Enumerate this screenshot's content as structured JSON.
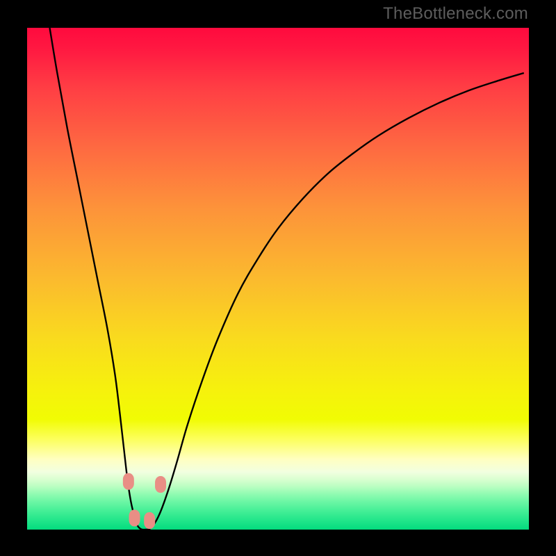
{
  "watermark": "TheBottleneck.com",
  "colors": {
    "background": "#000000",
    "curve_stroke": "#000000",
    "marker_fill": "#e98e85",
    "marker_stroke": "#c75148",
    "gradient_top": "#ff0a3e",
    "gradient_bottom": "#03db7e"
  },
  "chart_data": {
    "type": "line",
    "title": "",
    "xlabel": "",
    "ylabel": "",
    "xlim": [
      0,
      100
    ],
    "ylim": [
      0,
      100
    ],
    "x": [
      4.5,
      6.0,
      8.0,
      10.0,
      12.0,
      14.0,
      16.0,
      17.5,
      18.5,
      19.3,
      20.0,
      20.7,
      21.5,
      22.0,
      22.7,
      23.5,
      24.3,
      25.0,
      25.8,
      26.6,
      27.5,
      28.5,
      30.0,
      32.0,
      35.0,
      38.0,
      42.0,
      46.0,
      50.0,
      55.0,
      60.0,
      65.0,
      70.0,
      76.0,
      82.0,
      88.0,
      94.0,
      99.0
    ],
    "values": [
      100.0,
      91.0,
      80.0,
      70.0,
      60.0,
      50.0,
      40.0,
      31.0,
      23.0,
      16.0,
      10.0,
      5.5,
      2.2,
      0.8,
      0.1,
      0.0,
      0.1,
      0.7,
      1.9,
      3.6,
      6.0,
      9.0,
      14.0,
      21.0,
      30.0,
      38.0,
      47.0,
      54.0,
      60.0,
      66.0,
      71.0,
      75.0,
      78.5,
      82.0,
      85.0,
      87.5,
      89.5,
      91.0
    ],
    "markers": [
      {
        "x": 20.2,
        "y": 9.6
      },
      {
        "x": 21.4,
        "y": 2.3
      },
      {
        "x": 24.4,
        "y": 1.8
      },
      {
        "x": 26.6,
        "y": 9.0
      }
    ]
  }
}
